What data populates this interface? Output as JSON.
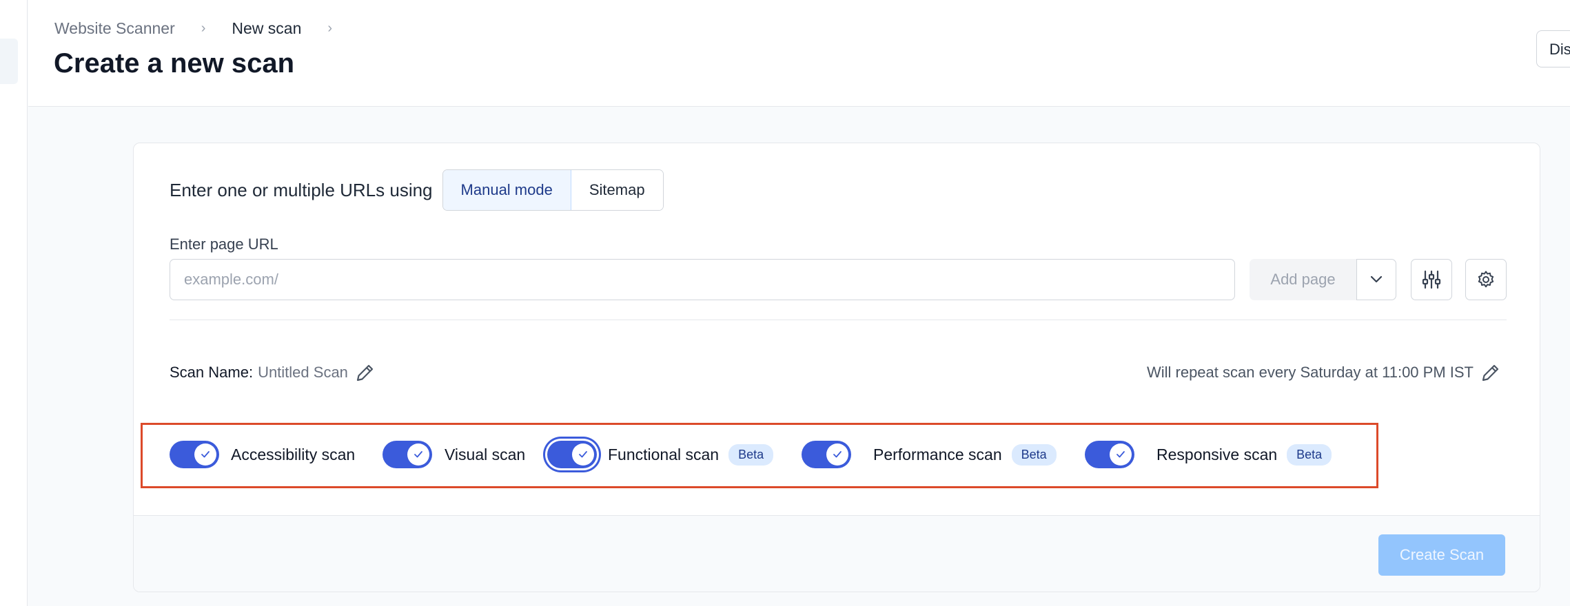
{
  "breadcrumb": {
    "items": [
      "Website Scanner",
      "New scan"
    ],
    "separator": "›"
  },
  "header": {
    "title": "Create a new scan",
    "discard_label": "Dis"
  },
  "form": {
    "mode_label": "Enter one or multiple URLs using",
    "modes": [
      "Manual mode",
      "Sitemap"
    ],
    "active_mode": "Manual mode",
    "url_label": "Enter page URL",
    "url_placeholder": "example.com/",
    "url_value": "",
    "add_page_label": "Add page",
    "scan_name_key": "Scan Name:",
    "scan_name_value": "Untitled Scan",
    "repeat_text": "Will repeat scan every Saturday at 11:00 PM IST",
    "create_label": "Create Scan"
  },
  "toggles": [
    {
      "label": "Accessibility scan",
      "on": true,
      "beta": ""
    },
    {
      "label": "Visual scan",
      "on": true,
      "beta": ""
    },
    {
      "label": "Functional scan",
      "on": true,
      "beta": "Beta",
      "focused": true
    },
    {
      "label": "Performance scan",
      "on": true,
      "beta": "Beta"
    },
    {
      "label": "Responsive scan",
      "on": true,
      "beta": "Beta"
    }
  ],
  "colors": {
    "accent": "#3b5bdb",
    "highlight_box": "#dc4a2a",
    "create_disabled": "#93c5fd"
  },
  "icons": [
    "chevron-right-icon",
    "chevron-down-icon",
    "sliders-icon",
    "gear-icon",
    "pencil-icon",
    "check-icon"
  ]
}
